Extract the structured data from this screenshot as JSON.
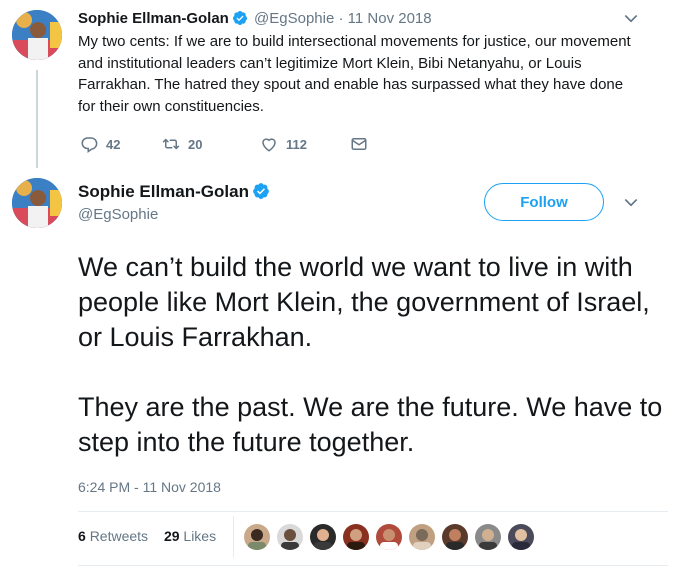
{
  "tweet1": {
    "name": "Sophie Ellman-Golan",
    "handle": "@EgSophie",
    "separator": "·",
    "date": "11 Nov 2018",
    "text": "My two cents: If we are to build intersectional movements for justice, our movement and institutional leaders can’t legitimize Mort Klein, Bibi Netanyahu, or Louis Farrakhan. The hatred they spout and enable has surpassed what they have done for their own constituencies.",
    "replies": "42",
    "retweets": "20",
    "likes": "112",
    "icons": [
      "verified-icon",
      "reply-icon",
      "retweet-icon",
      "like-icon",
      "message-icon",
      "chevron-down-icon"
    ]
  },
  "tweet2": {
    "name": "Sophie Ellman-Golan",
    "handle": "@EgSophie",
    "follow_label": "Follow",
    "paragraph1": "We can’t build the world we want to live in with people like Mort Klein, the government of Israel, or Louis Farrakhan.",
    "paragraph2": "They are the past. We are the future. We have to step into the future together.",
    "timestamp": "6:24 PM - 11 Nov 2018",
    "retweet_count": "6",
    "retweet_label": "Retweets",
    "like_count": "29",
    "like_label": "Likes",
    "liker_count": 9
  },
  "colors": {
    "accent": "#1da1f2",
    "secondary_text": "#657786",
    "divider": "#e6ecf0",
    "thread_line": "#ccd6dd"
  }
}
